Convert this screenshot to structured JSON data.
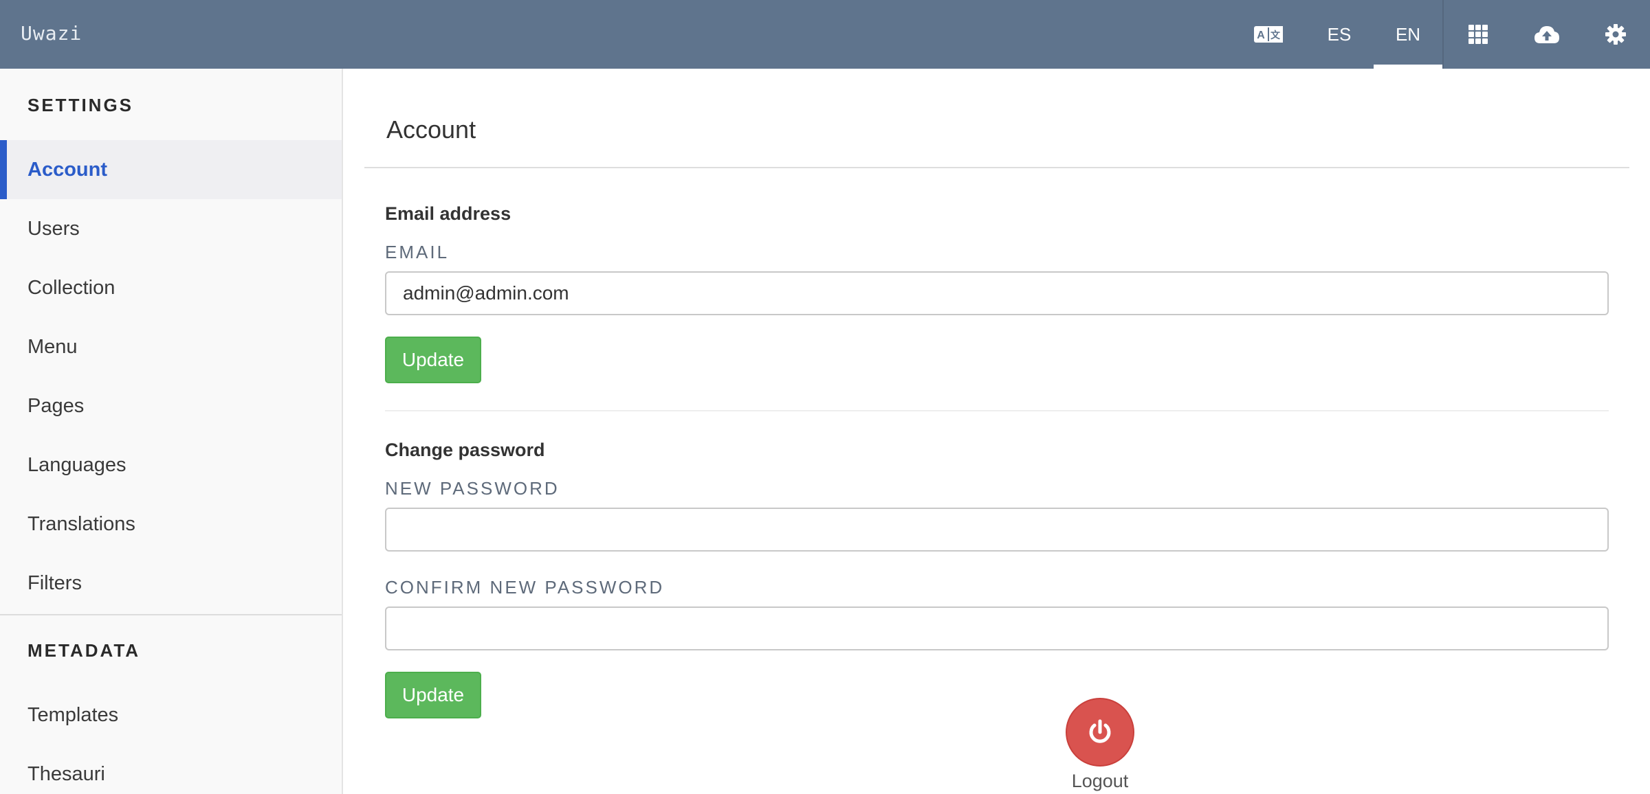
{
  "app": {
    "title": "Uwazi"
  },
  "header": {
    "translate_icon": "translate-icon",
    "languages": [
      {
        "label": "ES",
        "active": false
      },
      {
        "label": "EN",
        "active": true
      }
    ],
    "icons": [
      "grid-icon",
      "cloud-upload-icon",
      "gear-icon"
    ]
  },
  "sidebar": {
    "settings_heading": "SETTINGS",
    "items": [
      {
        "label": "Account",
        "active": true
      },
      {
        "label": "Users"
      },
      {
        "label": "Collection"
      },
      {
        "label": "Menu"
      },
      {
        "label": "Pages"
      },
      {
        "label": "Languages"
      },
      {
        "label": "Translations"
      },
      {
        "label": "Filters"
      }
    ],
    "metadata_heading": "METADATA",
    "metadata_items": [
      {
        "label": "Templates"
      },
      {
        "label": "Thesauri"
      }
    ]
  },
  "main": {
    "title": "Account",
    "email_section": {
      "title": "Email address",
      "label": "EMAIL",
      "value": "admin@admin.com",
      "button": "Update"
    },
    "password_section": {
      "title": "Change password",
      "new_label": "NEW PASSWORD",
      "new_value": "",
      "confirm_label": "CONFIRM NEW PASSWORD",
      "confirm_value": "",
      "button": "Update"
    },
    "logout": {
      "label": "Logout",
      "icon": "power-icon"
    }
  },
  "colors": {
    "topbar": "#5f748d",
    "accent": "#2b5cc9",
    "success": "#5cb85c",
    "danger": "#d9534f"
  }
}
